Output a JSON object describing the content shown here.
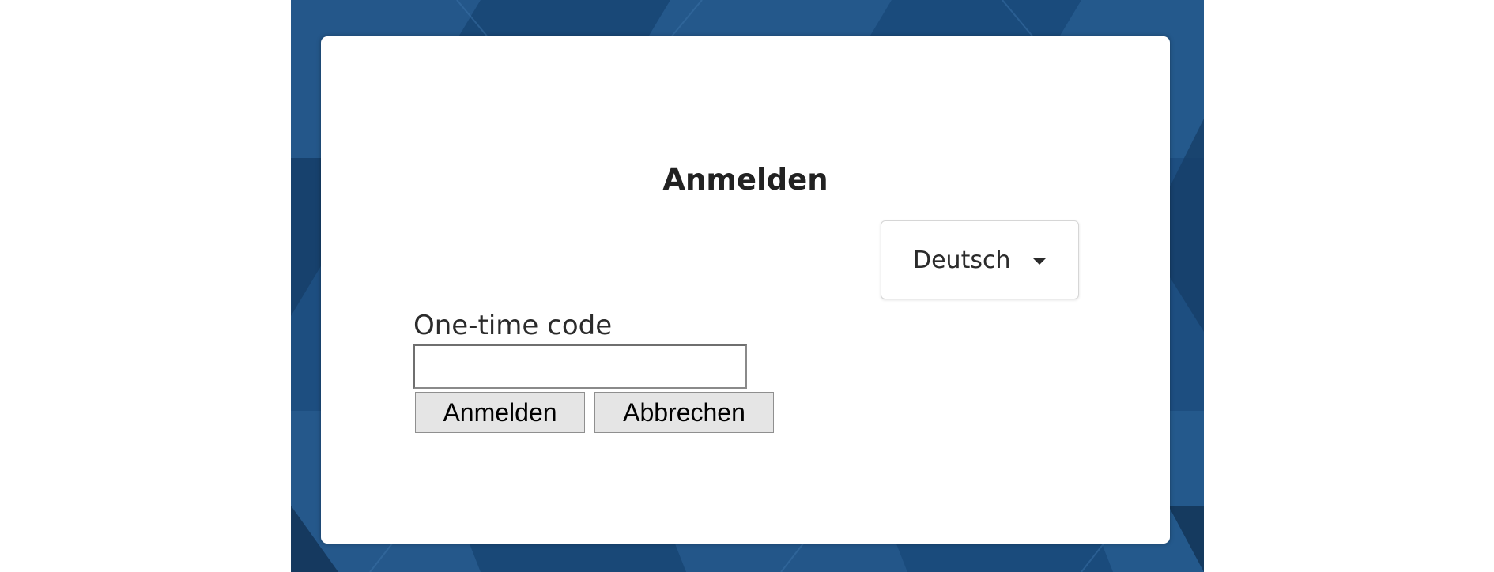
{
  "login": {
    "title": "Anmelden",
    "language": {
      "selected": "Deutsch",
      "icon": "caret-down-icon"
    },
    "otp": {
      "label": "One-time code",
      "value": ""
    },
    "buttons": {
      "submit_label": "Anmelden",
      "cancel_label": "Abbrechen"
    }
  },
  "colors": {
    "background": "#1d4e80",
    "card": "#ffffff",
    "button": "#e5e5e5"
  }
}
